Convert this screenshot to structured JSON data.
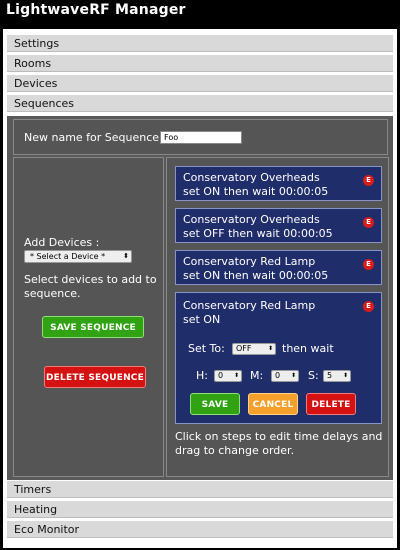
{
  "app": {
    "title": "LightwaveRF Manager"
  },
  "accordion": {
    "settings": "Settings",
    "rooms": "Rooms",
    "devices": "Devices",
    "sequences": "Sequences",
    "timers": "Timers",
    "heating": "Heating",
    "eco_monitor": "Eco Monitor"
  },
  "sequence": {
    "name_label": "New name for Sequence",
    "name_value": "Foo",
    "add_devices_label": "Add Devices :",
    "device_select": "* Select a Device *",
    "help_left": "Select devices to add to sequence.",
    "save_sequence": "SAVE SEQUENCE",
    "delete_sequence": "DELETE SEQUENCE",
    "steps": [
      {
        "device": "Conservatory Overheads",
        "action": "set ON then wait 00:00:05",
        "badge": "E"
      },
      {
        "device": "Conservatory Overheads",
        "action": "set OFF then wait 00:00:05",
        "badge": "E"
      },
      {
        "device": "Conservatory Red Lamp",
        "action": "set ON then wait 00:00:05",
        "badge": "E"
      }
    ],
    "editing_step": {
      "device": "Conservatory Red Lamp",
      "action": "set ON",
      "badge": "E",
      "set_to_label": "Set To:",
      "set_to_value": "OFF",
      "then_wait": "then wait",
      "h_label": "H:",
      "h_value": "0",
      "m_label": "M:",
      "m_value": "0",
      "s_label": "S:",
      "s_value": "5",
      "save": "SAVE",
      "cancel": "CANCEL",
      "delete": "DELETE"
    },
    "help_right": "Click on steps to edit time delays and drag to change order."
  },
  "colors": {
    "header_bg": "#000000",
    "accordion_bg": "#d9d9d9",
    "panel_bg": "#555555",
    "step_bg": "#1f2d6a",
    "green": "#31a313",
    "red": "#d41212",
    "orange": "#f4a02a"
  }
}
